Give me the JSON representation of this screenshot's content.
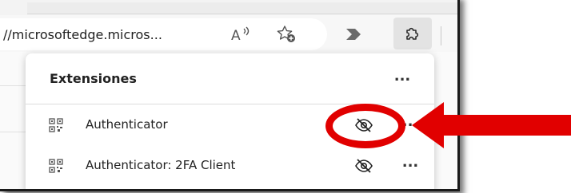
{
  "browser": {
    "url_text": "//microsoftedge.micros...",
    "icons": {
      "read_aloud": "read-aloud-icon",
      "favorites": "add-favorite-icon",
      "forward_extension": "extension-arrow-icon",
      "extensions": "puzzle-extensions-icon"
    }
  },
  "extensions_panel": {
    "title": "Extensiones",
    "more_label": "...",
    "items": [
      {
        "name": "Authenticator",
        "hide_icon": "eye-slash-icon",
        "more_label": "..."
      },
      {
        "name": "Authenticator: 2FA Client",
        "hide_icon": "eye-slash-icon",
        "more_label": "..."
      }
    ]
  },
  "annotation": {
    "highlight_color": "#e10000",
    "shape": "ellipse-around-hide-icon",
    "arrow_direction": "left"
  }
}
